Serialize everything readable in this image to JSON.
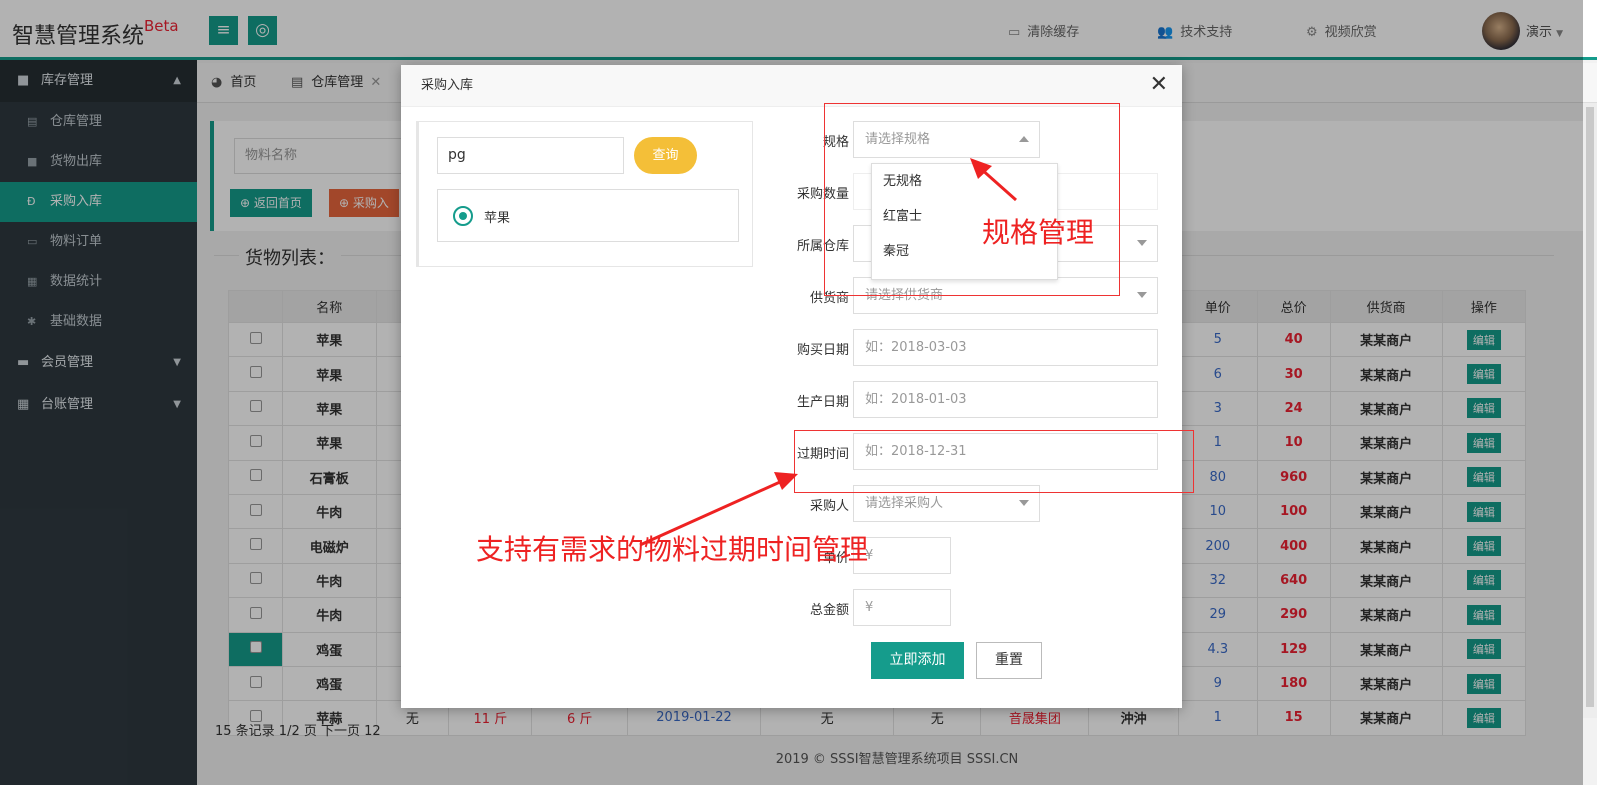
{
  "app": {
    "title": "智慧管理系统",
    "badge": "Beta"
  },
  "topnav": [
    {
      "icon": "monitor-icon",
      "label": "清除缓存"
    },
    {
      "icon": "users-icon",
      "label": "技术支持"
    },
    {
      "icon": "gears-icon",
      "label": "视频欣赏"
    }
  ],
  "user": {
    "name": "演示"
  },
  "sidebar": {
    "groups": [
      {
        "label": "库存管理",
        "open": true,
        "items": [
          {
            "label": "仓库管理"
          },
          {
            "label": "货物出库"
          },
          {
            "label": "采购入库",
            "active": true
          },
          {
            "label": "物料订单"
          },
          {
            "label": "数据统计"
          },
          {
            "label": "基础数据"
          }
        ]
      },
      {
        "label": "会员管理"
      },
      {
        "label": "台账管理"
      }
    ]
  },
  "tabs": [
    {
      "label": "首页"
    },
    {
      "label": "仓库管理"
    }
  ],
  "workspace": {
    "search_placeholder": "物料名称",
    "back_label": "返回首页",
    "purchase_label": "采购入"
  },
  "list": {
    "legend": "货物列表：",
    "headers": {
      "name": "名称",
      "price": "单价",
      "total": "总价",
      "supplier": "供货商",
      "action": "操作"
    },
    "edit_label": "编辑",
    "rows": [
      {
        "name": "苹果",
        "price": "5",
        "total": "40",
        "supplier": "某某商户"
      },
      {
        "name": "苹果",
        "price": "6",
        "total": "30",
        "supplier": "某某商户"
      },
      {
        "name": "苹果",
        "price": "3",
        "total": "24",
        "supplier": "某某商户"
      },
      {
        "name": "苹果",
        "price": "1",
        "total": "10",
        "supplier": "某某商户"
      },
      {
        "name": "石膏板",
        "price": "80",
        "total": "960",
        "supplier": "某某商户"
      },
      {
        "name": "牛肉",
        "price": "10",
        "total": "100",
        "supplier": "某某商户"
      },
      {
        "name": "电磁炉",
        "price": "200",
        "total": "400",
        "supplier": "某某商户"
      },
      {
        "name": "牛肉",
        "price": "32",
        "total": "640",
        "supplier": "某某商户"
      },
      {
        "name": "牛肉",
        "price": "29",
        "total": "290",
        "supplier": "某某商户"
      },
      {
        "name": "鸡蛋",
        "price": "4.3",
        "total": "129",
        "supplier": "某某商户",
        "selected": true
      },
      {
        "name": "鸡蛋",
        "price": "9",
        "total": "180",
        "supplier": "某某商户"
      }
    ],
    "partial_row": {
      "name": "苹蒜",
      "c2": "无",
      "c3": "11 斤",
      "c4": "6 斤",
      "c5": "2019-01-22",
      "c6": "无",
      "c7": "无",
      "c8": "音晟集团",
      "c9": "沖沖",
      "price": "1",
      "total": "15",
      "supplier": "某某商户"
    },
    "pager": "15 条记录 1/2 页 下一页 12"
  },
  "footer": "2019 ©  SSSI智慧管理系统项目  SSSI.CN",
  "modal": {
    "title": "采购入库",
    "search_value": "pg",
    "query_label": "查询",
    "result_label": "苹果",
    "fields": {
      "spec": {
        "label": "规格",
        "placeholder": "请选择规格"
      },
      "qty": {
        "label": "采购数量"
      },
      "warehouse": {
        "label": "所属仓库"
      },
      "supplier": {
        "label": "供货商",
        "placeholder": "请选择供货商"
      },
      "buy_date": {
        "label": "购买日期",
        "placeholder": "如：2018-03-03"
      },
      "prod_date": {
        "label": "生产日期",
        "placeholder": "如：2018-01-03"
      },
      "expire": {
        "label": "过期时间",
        "placeholder": "如：2018-12-31"
      },
      "buyer": {
        "label": "采购人",
        "placeholder": "请选择采购人"
      },
      "unit_price": {
        "label": "单价",
        "placeholder": "¥"
      },
      "total": {
        "label": "总金额",
        "placeholder": "¥"
      }
    },
    "spec_options": [
      "无规格",
      "红富士",
      "秦冠"
    ],
    "add_label": "立即添加",
    "reset_label": "重置"
  },
  "annotations": {
    "spec_note": "规格管理",
    "expire_note": "支持有需求的物料过期时间管理"
  },
  "colors": {
    "accent": "#159c8c",
    "query": "#f4bf38",
    "annotation": "#e22222"
  }
}
